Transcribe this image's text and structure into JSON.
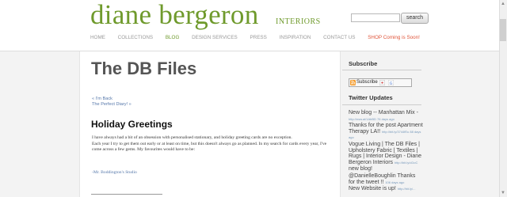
{
  "header": {
    "logo": "diane bergeron",
    "logo_sub": "INTERIORS",
    "search_placeholder": "",
    "search_button": "search"
  },
  "nav": {
    "items": [
      "HOME",
      "COLLECTIONS",
      "BLOG",
      "DESIGN SERVICES",
      "PRESS",
      "INSPIRATION",
      "CONTACT US",
      "SHOP Coming is Soon!"
    ],
    "active": "BLOG",
    "colors": {
      "normal": "#999999",
      "active": "#6f9a2c",
      "shop": "#e0553a"
    }
  },
  "main": {
    "title": "The DB Files",
    "prev_link": "« I'm Back",
    "next_link": "The Perfect Diary! »",
    "post_title": "Holiday Greetings",
    "paragraphs": [
      "I have always had a bit of an obsession with personalised stationary, and holiday greeting cards are no exception.",
      "Each year I try to get them out early or at least on time, but this doesn't always go as planned. In my search for cards every year, I've come across a few gems. My favourites would have to be:"
    ],
    "caption": "-Mr. Boddington's Studio"
  },
  "sidebar": {
    "subscribe_heading": "Subscribe",
    "subscribe_label": "Subscribe",
    "twitter_heading": "Twitter Updates",
    "tweets": [
      {
        "text": "New blog -- Manhattan Mix -",
        "link": "http://nsw.ai/1AbBD 76 days ago"
      },
      {
        "text": "Thanks for the post Apartment Therapy LA!!",
        "link": "http://bit.ly/3744fEu 88 days ago"
      },
      {
        "text": "Vogue Living | The DB Files | Upholstery Fabric | Textiles | Rugs | Interior Design - Diane Bergeron Interiors",
        "link": "http://bit.ly/cDoC"
      },
      {
        "text": "new blog!",
        "link": ""
      },
      {
        "text": "@DanielleBoughlin Thanks for the tweet !!",
        "link": "106 days ago"
      },
      {
        "text": "New Website is up!",
        "link": "http://bit.ly/..."
      }
    ]
  }
}
